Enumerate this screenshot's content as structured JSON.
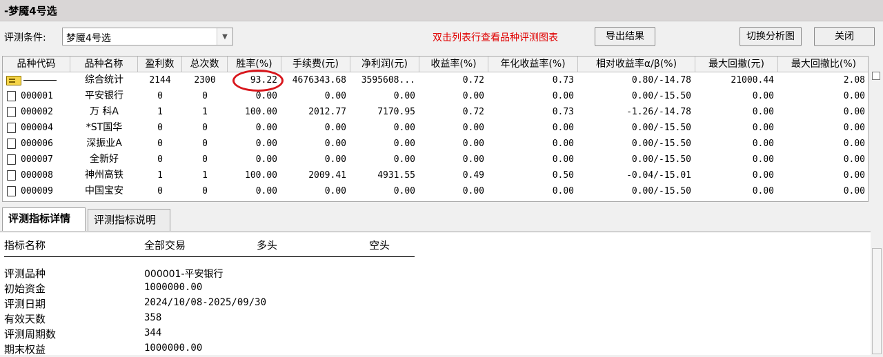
{
  "window": {
    "title": "-梦魇4号选"
  },
  "toolbar": {
    "condition_label": "评测条件:",
    "condition_value": "梦魇4号选",
    "hint": "双击列表行查看品种评测图表",
    "export_label": "导出结果",
    "switch_label": "切换分析图",
    "close_label": "关闭"
  },
  "table": {
    "headers": [
      "品种代码",
      "品种名称",
      "盈利数",
      "总次数",
      "胜率(%)",
      "手续费(元)",
      "净利润(元)",
      "收益率(%)",
      "年化收益率(%)",
      "相对收益率α/β(%)",
      "最大回撤(元)",
      "最大回撤比(%)"
    ],
    "rows": [
      {
        "code": "",
        "name": "综合统计",
        "win": "2144",
        "total": "2300",
        "rate": "93.22",
        "fee": "4676343.68",
        "profit": "3595608...",
        "ret": "0.72",
        "annual": "0.73",
        "rel": "0.80/-14.78",
        "dd": "21000.44",
        "ddr": "2.08"
      },
      {
        "code": "000001",
        "name": "平安银行",
        "win": "0",
        "total": "0",
        "rate": "0.00",
        "fee": "0.00",
        "profit": "0.00",
        "ret": "0.00",
        "annual": "0.00",
        "rel": "0.00/-15.50",
        "dd": "0.00",
        "ddr": "0.00"
      },
      {
        "code": "000002",
        "name": "万 科A",
        "win": "1",
        "total": "1",
        "rate": "100.00",
        "fee": "2012.77",
        "profit": "7170.95",
        "ret": "0.72",
        "annual": "0.73",
        "rel": "-1.26/-14.78",
        "dd": "0.00",
        "ddr": "0.00"
      },
      {
        "code": "000004",
        "name": "*ST国华",
        "win": "0",
        "total": "0",
        "rate": "0.00",
        "fee": "0.00",
        "profit": "0.00",
        "ret": "0.00",
        "annual": "0.00",
        "rel": "0.00/-15.50",
        "dd": "0.00",
        "ddr": "0.00"
      },
      {
        "code": "000006",
        "name": "深振业A",
        "win": "0",
        "total": "0",
        "rate": "0.00",
        "fee": "0.00",
        "profit": "0.00",
        "ret": "0.00",
        "annual": "0.00",
        "rel": "0.00/-15.50",
        "dd": "0.00",
        "ddr": "0.00"
      },
      {
        "code": "000007",
        "name": "全新好",
        "win": "0",
        "total": "0",
        "rate": "0.00",
        "fee": "0.00",
        "profit": "0.00",
        "ret": "0.00",
        "annual": "0.00",
        "rel": "0.00/-15.50",
        "dd": "0.00",
        "ddr": "0.00"
      },
      {
        "code": "000008",
        "name": "神州高铁",
        "win": "1",
        "total": "1",
        "rate": "100.00",
        "fee": "2009.41",
        "profit": "4931.55",
        "ret": "0.49",
        "annual": "0.50",
        "rel": "-0.04/-15.01",
        "dd": "0.00",
        "ddr": "0.00"
      },
      {
        "code": "000009",
        "name": "中国宝安",
        "win": "0",
        "total": "0",
        "rate": "0.00",
        "fee": "0.00",
        "profit": "0.00",
        "ret": "0.00",
        "annual": "0.00",
        "rel": "0.00/-15.50",
        "dd": "0.00",
        "ddr": "0.00"
      }
    ]
  },
  "tabs": {
    "detail": "评测指标详情",
    "explain": "评测指标说明"
  },
  "detail": {
    "col_headers": [
      "指标名称",
      "全部交易",
      "多头",
      "空头"
    ],
    "rows": [
      {
        "label": "评测品种",
        "value": "000001-平安银行"
      },
      {
        "label": "初始资金",
        "value": "1000000.00"
      },
      {
        "label": "评测日期",
        "value": "2024/10/08-2025/09/30"
      },
      {
        "label": "有效天数",
        "value": "358"
      },
      {
        "label": "评测周期数",
        "value": "344"
      },
      {
        "label": "期末权益",
        "value": "1000000.00"
      }
    ]
  },
  "colors": {
    "hint": "#e00000",
    "highlight_circle": "#d8161c"
  }
}
